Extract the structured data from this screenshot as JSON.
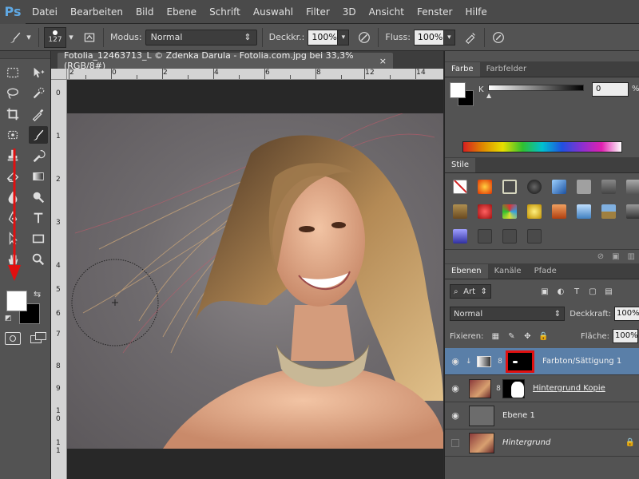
{
  "app": {
    "logo": "Ps",
    "accent": "#5fa8e3"
  },
  "menu": [
    "Datei",
    "Bearbeiten",
    "Bild",
    "Ebene",
    "Schrift",
    "Auswahl",
    "Filter",
    "3D",
    "Ansicht",
    "Fenster",
    "Hilfe"
  ],
  "options": {
    "brush_size": "127",
    "mode_label": "Modus:",
    "mode_value": "Normal",
    "opacity_label": "Deckkr.:",
    "opacity_value": "100%",
    "flow_label": "Fluss:",
    "flow_value": "100%",
    "chevron": "▾"
  },
  "document": {
    "tab_title": "Fotolia_12463713_L © Zdenka Darula - Fotolia.com.jpg bei 33,3% (RGB/8#)",
    "close": "×",
    "ruler_top": [
      "2",
      "0",
      "2",
      "4",
      "6",
      "8",
      "1",
      "2",
      "1",
      "4",
      "1",
      "6",
      "1",
      "8"
    ],
    "ruler_left": [
      "0",
      "1",
      "2",
      "3",
      "4",
      "5",
      "6",
      "7",
      "8",
      "9",
      "1 0",
      "1 1"
    ]
  },
  "color_panel": {
    "tabs": [
      "Farbe",
      "Farbfelder"
    ],
    "channel": "K",
    "value": "0",
    "unit": "%",
    "thumb": "▲"
  },
  "styles_panel": {
    "tab": "Stile",
    "swatches": [
      "#c03030",
      "#e85a10",
      "#2d2d2d",
      "#1a1a1a",
      "#2a5fb0",
      "#909090",
      "#6a6a6a",
      "#707070",
      "#8a6a30",
      "#c02020",
      "#30a0c0",
      "#e0c000",
      "#d07030",
      "#5a9ad0",
      "#a08040",
      "#6a6a6a",
      "#5050b0",
      "#3a3a3a",
      "#3a3a3a",
      "#3a3a3a"
    ]
  },
  "layers_panel": {
    "tabs": [
      "Ebenen",
      "Kanäle",
      "Pfade"
    ],
    "kind": "Art",
    "blend": "Normal",
    "opacity_label": "Deckkraft:",
    "opacity_value": "100%",
    "lock_label": "Fixieren:",
    "fill_label": "Fläche:",
    "fill_value": "100%",
    "lock_glyph": "🔒",
    "eye": "◉",
    "chain": "8",
    "layers": [
      {
        "name": "Farbton/Sättigung 1",
        "selected": true
      },
      {
        "name": "Hintergrund Kopie",
        "selected": false
      },
      {
        "name": "Ebene 1",
        "selected": false
      },
      {
        "name": "Hintergrund",
        "selected": false
      }
    ]
  }
}
